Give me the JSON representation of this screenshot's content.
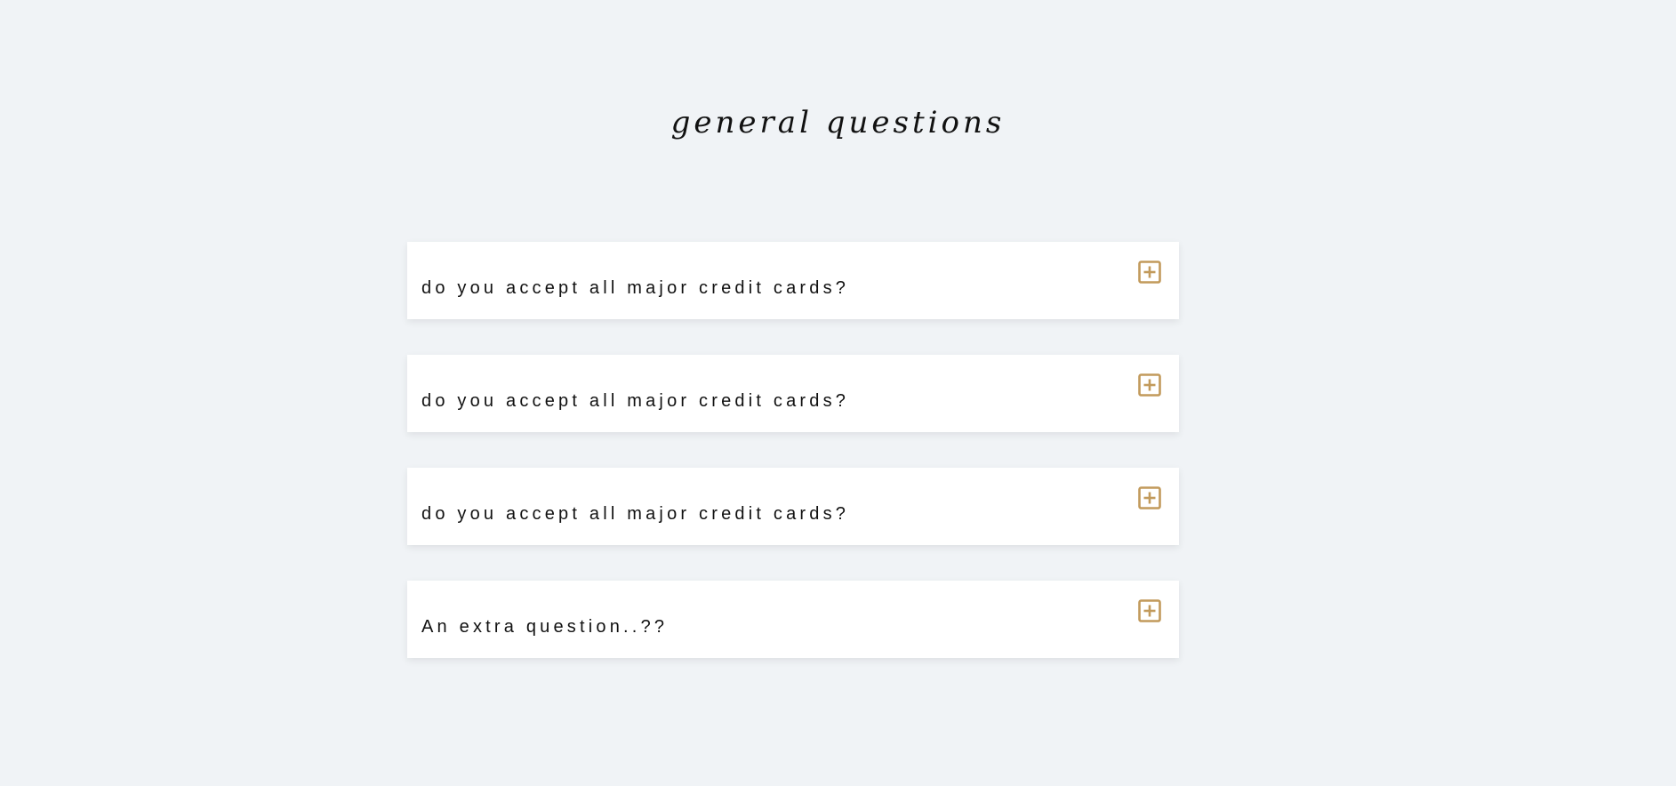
{
  "page": {
    "title": "general questions"
  },
  "faq": {
    "items": [
      {
        "question": "do you accept all major credit cards?",
        "icon": "plus-square-icon"
      },
      {
        "question": "do you accept all major credit cards?",
        "icon": "plus-square-icon"
      },
      {
        "question": "do you accept all major credit cards?",
        "icon": "plus-square-icon"
      },
      {
        "question": "An extra question..??",
        "icon": "plus-square-icon"
      }
    ]
  },
  "colors": {
    "background": "#f0f3f6",
    "card": "#ffffff",
    "accent": "#c29a5b",
    "text": "#111111"
  }
}
